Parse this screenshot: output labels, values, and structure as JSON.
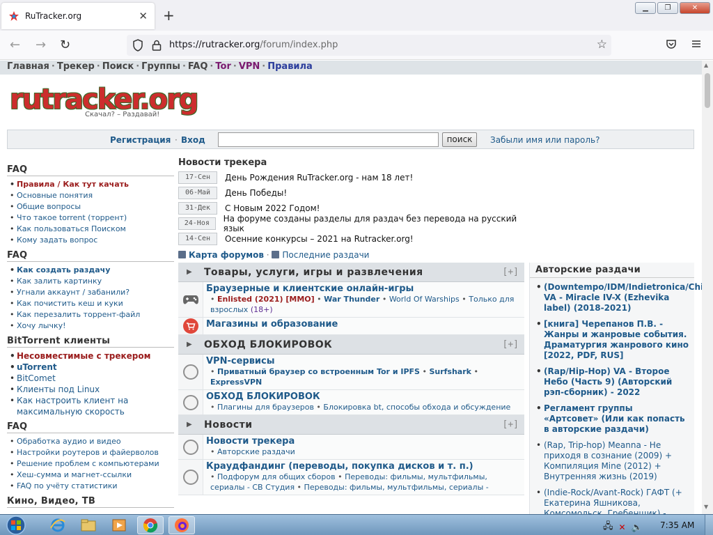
{
  "browser": {
    "tab_title": "RuTracker.org",
    "url_host": "https://rutracker.org",
    "url_path": "/forum/index.php",
    "accent": "#0060df"
  },
  "topmenu": [
    "Главная",
    "Трекер",
    "Поиск",
    "Группы",
    "FAQ",
    "Tor",
    "VPN",
    "Правила"
  ],
  "logo": {
    "text": "rutracker.org",
    "slogan": "Скачал? – Раздавай!"
  },
  "login": {
    "register": "Регистрация",
    "login": "Вход",
    "search_btn": "поиск",
    "forgot": "Забыли имя или пароль?"
  },
  "sidebar": [
    {
      "title": "FAQ",
      "items": [
        {
          "label": "Правила / Как тут качать",
          "style": "red"
        },
        {
          "label": "Основные понятия"
        },
        {
          "label": "Общие вопросы"
        },
        {
          "label": "Что такое torrent (торрент)"
        },
        {
          "label": "Как пользоваться Поиском"
        },
        {
          "label": "Кому задать вопрос"
        }
      ]
    },
    {
      "title": "FAQ",
      "items": [
        {
          "label": "Как создать раздачу",
          "style": "bold"
        },
        {
          "label": "Как залить картинку"
        },
        {
          "label": "Угнали аккаунт / забанили?"
        },
        {
          "label": "Как почистить кеш и куки"
        },
        {
          "label": "Как перезалить торрент-файл"
        },
        {
          "label": "Хочу лычку!"
        }
      ]
    },
    {
      "title": "BitTorrent клиенты",
      "items": [
        {
          "label": "Несовместимые с трекером",
          "style": "red"
        },
        {
          "label": "uTorrent",
          "style": "bold"
        },
        {
          "label": "BitComet"
        },
        {
          "label": "Клиенты под Linux"
        },
        {
          "label": "Как настроить клиент на максимальную скорость"
        }
      ]
    },
    {
      "title": "FAQ",
      "items": [
        {
          "label": "Обработка аудио и видео"
        },
        {
          "label": "Настройки роутеров и файерволов"
        },
        {
          "label": "Решение проблем с компьютерами"
        },
        {
          "label": "Хеш-сумма и магнет-ссылки"
        },
        {
          "label": "FAQ по учёту статистики"
        }
      ]
    },
    {
      "title": "Кино, Видео, ТВ",
      "items": []
    }
  ],
  "news": {
    "title": "Новости трекера",
    "items": [
      {
        "date": "17-Сен",
        "text": "День Рождения RuTracker.org - нам 18 лет!"
      },
      {
        "date": "06-Май",
        "text": "День Победы!"
      },
      {
        "date": "31-Дек",
        "text": "С Новым 2022 Годом!"
      },
      {
        "date": "24-Ноя",
        "text": "На форуме созданы разделы для раздач без перевода на русский язык"
      },
      {
        "date": "14-Сен",
        "text": "Осенние конкурсы – 2021 на Rutracker.org!"
      }
    ]
  },
  "links": {
    "forum_map": "Карта форумов",
    "latest": "Последние раздачи"
  },
  "categories": [
    {
      "title": "Товары, услуги, игры и развлечения",
      "plus": "[+]",
      "forums": [
        {
          "name": "Браузерные и клиентские онлайн-игры",
          "icon": "gamepad",
          "subs": [
            {
              "text": "Enlisted (2021) [MMO]",
              "style": "r"
            },
            {
              "text": "War Thunder",
              "style": "bb"
            },
            {
              "text": "World Of Warships"
            },
            {
              "text": "Только для взрослых"
            },
            {
              "text": "(18+)",
              "style": "purple"
            }
          ]
        },
        {
          "name": "Магазины и образование",
          "icon": "cart",
          "subs": []
        }
      ]
    },
    {
      "title": "ОБХОД БЛОКИРОВОК",
      "plus": "[+]",
      "forums": [
        {
          "name": "VPN-сервисы",
          "icon": "circle",
          "subs": [
            {
              "text": "Приватный браузер со встроенным Tor и IPFS",
              "style": "bb"
            },
            {
              "text": "Surfshark",
              "style": "bb"
            },
            {
              "text": "ExpressVPN",
              "style": "bb"
            }
          ]
        },
        {
          "name": "ОБХОД БЛОКИРОВОК",
          "icon": "circle",
          "subs": [
            {
              "text": "Плагины для браузеров"
            },
            {
              "text": "Блокировка bt, способы обхода и обсуждение"
            }
          ]
        }
      ]
    },
    {
      "title": "Новости",
      "plus": "[+]",
      "forums": [
        {
          "name": "Новости трекера",
          "icon": "circle",
          "subs": [
            {
              "text": "Авторские раздачи"
            }
          ]
        },
        {
          "name": "Краудфандинг (переводы, покупка дисков и т. п.)",
          "icon": "circle",
          "subs": [
            {
              "text": "Подфорум для общих сборов"
            },
            {
              "text": "Переводы: фильмы, мультфильмы, сериалы - СВ Студия"
            },
            {
              "text": "Переводы: фильмы, мультфильмы, сериалы -"
            }
          ]
        }
      ]
    }
  ],
  "authors": {
    "title": "Авторские раздачи",
    "items": [
      {
        "text": "(Downtempo/IDM/Indietronica/Chillout) VA - Miracle IV-X (Ezhevika label) (2018-2021)",
        "bold": true
      },
      {
        "text": "[книга] Черепанов П.В. - Жанры и жанровые события. Драматургия жанрового кино [2022, PDF, RUS]",
        "bold": true
      },
      {
        "text": "(Rap/Hip-Hop) VA - Второе Небо (Часть 9) (Авторский рэп-сборник) - 2022",
        "bold": true
      },
      {
        "text": "Регламент группы «Артсовет» (Или как попасть в авторские раздачи)",
        "bold": true
      },
      {
        "text": "(Rap, Trip-hop) Meanna - Не приходя в сознание (2009) + Компиляция Mine (2012) + Внутренняя жизнь (2019)",
        "bold": false
      },
      {
        "text": "(Indie-Rock/Avant-Rock) ГАФТ (+ Екатерина Яшникова, Комсомольск, Гребенщик) -",
        "bold": false
      }
    ]
  },
  "taskbar": {
    "time": "7:35 AM"
  }
}
